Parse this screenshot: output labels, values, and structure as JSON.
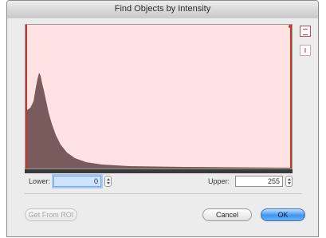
{
  "window": {
    "title": "Find Objects by Intensity"
  },
  "histogram": {
    "fill_color": "#7a5b5b",
    "background_color": "#ffe3e3",
    "threshold_color": "#c0392b",
    "lower_marker": 0,
    "upper_marker": 255
  },
  "lower": {
    "label": "Lower:",
    "value": "0"
  },
  "upper": {
    "label": "Upper:",
    "value": "255"
  },
  "buttons": {
    "get_from_roi": "Get From ROI",
    "cancel": "Cancel",
    "ok": "OK"
  },
  "icons": {
    "fit": "fit-histogram-icon",
    "zoom": "zoom-histogram-icon"
  }
}
